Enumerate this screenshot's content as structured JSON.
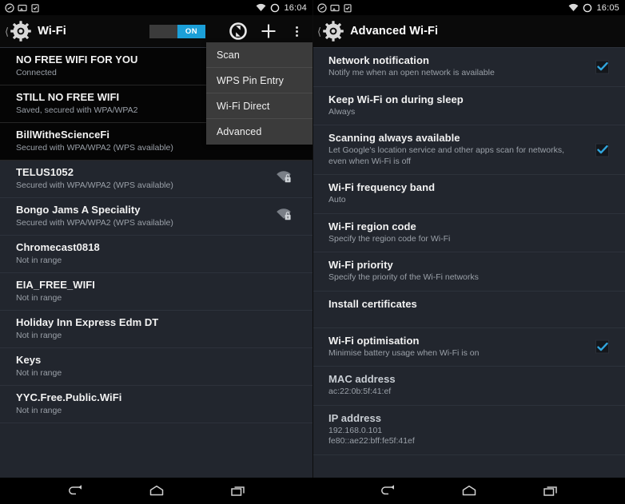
{
  "left": {
    "statusbar": {
      "icons": [
        "dnd-icon",
        "screenshot-icon",
        "clipboard-icon"
      ],
      "wifi_icon": "wifi-icon",
      "circle_icon": "circle-icon",
      "clock": "16:04"
    },
    "actionbar": {
      "back_icon": "back-chevron-icon",
      "app_icon": "settings-gear-icon",
      "title": "Wi-Fi",
      "toggle_label": "ON",
      "wps_icon": "wps-refresh-icon",
      "add_icon": "plus-icon",
      "overflow_icon": "overflow-menu-icon"
    },
    "networks": [
      {
        "name": "NO FREE WIFI FOR YOU",
        "status": "Connected",
        "icon": "",
        "highlight": true
      },
      {
        "name": "STILL NO FREE WIFI",
        "status": "Saved, secured with WPA/WPA2",
        "icon": "",
        "highlight": true
      },
      {
        "name": "BillWitheScienceFi",
        "status": "Secured with WPA/WPA2 (WPS available)",
        "icon": "",
        "highlight": true
      },
      {
        "name": "TELUS1052",
        "status": "Secured with WPA/WPA2 (WPS available)",
        "icon": "wifi-lock-icon",
        "highlight": false
      },
      {
        "name": "Bongo Jams A Speciality",
        "status": "Secured with WPA/WPA2 (WPS available)",
        "icon": "wifi-lock-icon",
        "highlight": false
      },
      {
        "name": "Chromecast0818",
        "status": "Not in range",
        "icon": "",
        "highlight": false
      },
      {
        "name": "EIA_FREE_WIFI",
        "status": "Not in range",
        "icon": "",
        "highlight": false
      },
      {
        "name": "Holiday Inn Express Edm DT",
        "status": "Not in range",
        "icon": "",
        "highlight": false
      },
      {
        "name": "Keys",
        "status": "Not in range",
        "icon": "",
        "highlight": false
      },
      {
        "name": "YYC.Free.Public.WiFi",
        "status": "Not in range",
        "icon": "",
        "highlight": false
      }
    ],
    "menu": {
      "items": [
        {
          "label": "Scan"
        },
        {
          "label": "WPS Pin Entry"
        },
        {
          "label": "Wi-Fi Direct"
        },
        {
          "label": "Advanced"
        }
      ]
    }
  },
  "right": {
    "statusbar": {
      "icons": [
        "dnd-icon",
        "screenshot-icon",
        "clipboard-icon"
      ],
      "wifi_icon": "wifi-icon",
      "circle_icon": "circle-icon",
      "clock": "16:05"
    },
    "actionbar": {
      "back_icon": "back-chevron-icon",
      "app_icon": "settings-gear-icon",
      "title": "Advanced Wi-Fi"
    },
    "settings": [
      {
        "title": "Network notification",
        "sub": "Notify me when an open network is available",
        "checked": true
      },
      {
        "title": "Keep Wi-Fi on during sleep",
        "sub": "Always",
        "checked": false
      },
      {
        "title": "Scanning always available",
        "sub": "Let Google's location service and other apps scan for networks, even when Wi-Fi is off",
        "checked": true
      },
      {
        "title": "Wi-Fi frequency band",
        "sub": "Auto",
        "checked": false
      },
      {
        "title": "Wi-Fi region code",
        "sub": "Specify the region code for Wi-Fi",
        "checked": false
      },
      {
        "title": "Wi-Fi priority",
        "sub": "Specify the priority of the Wi-Fi networks",
        "checked": false
      },
      {
        "title": "Install certificates",
        "sub": "",
        "checked": false
      },
      {
        "title": "Wi-Fi optimisation",
        "sub": "Minimise battery usage when Wi-Fi is on",
        "checked": true
      },
      {
        "title": "MAC address",
        "sub": "ac:22:0b:5f:41:ef",
        "checked": false,
        "dim": true
      },
      {
        "title": "IP address",
        "sub": "192.168.0.101\nfe80::ae22:bff:fe5f:41ef",
        "checked": false,
        "dim": true
      }
    ]
  },
  "navbar": {
    "back_icon": "nav-back-icon",
    "home_icon": "nav-home-icon",
    "recents_icon": "nav-recents-icon"
  },
  "colors": {
    "accent": "#1b9fd8",
    "check": "#30a5dd",
    "panel_bg": "#22262e",
    "actionbar_bg": "#0a0a0a",
    "menu_bg": "#3b3b3b"
  }
}
